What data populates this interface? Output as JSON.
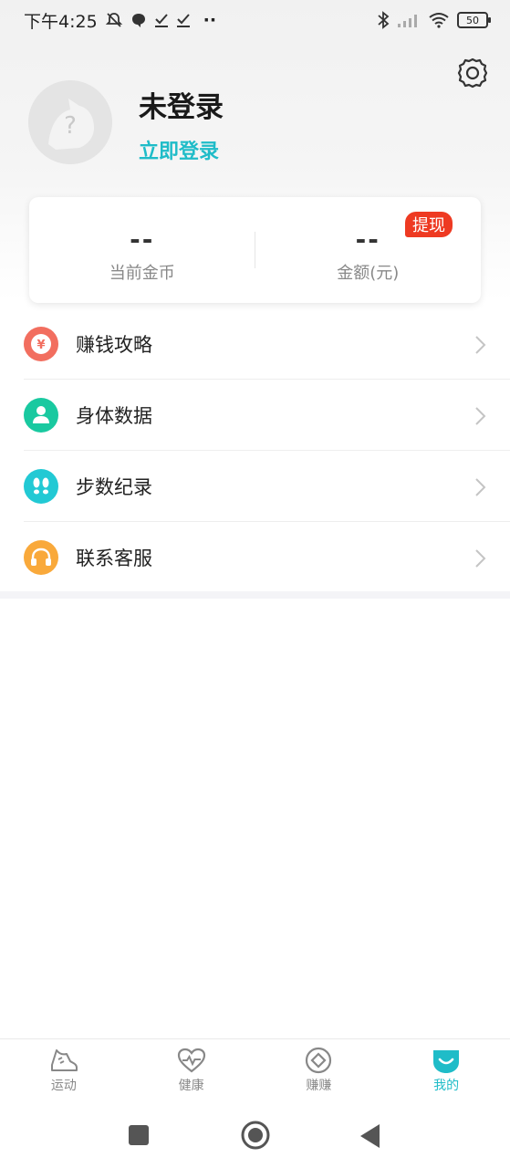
{
  "status_bar": {
    "time": "下午4:25",
    "dots": "··",
    "battery": "50"
  },
  "profile": {
    "name": "未登录",
    "login_link": "立即登录"
  },
  "stats": {
    "coins_value": "--",
    "coins_label": "当前金币",
    "amount_value": "--",
    "amount_label": "金额(元)",
    "withdraw_badge": "提现"
  },
  "menu": {
    "items": [
      {
        "label": "赚钱攻略",
        "icon": "yen-icon",
        "color": "#f26e5f"
      },
      {
        "label": "身体数据",
        "icon": "person-icon",
        "color": "#19c9a0"
      },
      {
        "label": "步数纪录",
        "icon": "footprints-icon",
        "color": "#22c9d4"
      },
      {
        "label": "联系客服",
        "icon": "headphones-icon",
        "color": "#f9a93b"
      }
    ]
  },
  "tabs": [
    {
      "label": "运动",
      "icon": "shoe-icon"
    },
    {
      "label": "健康",
      "icon": "heart-pulse-icon"
    },
    {
      "label": "赚赚",
      "icon": "diamond-coin-icon"
    },
    {
      "label": "我的",
      "icon": "smile-icon",
      "active": true
    }
  ],
  "colors": {
    "accent": "#1fbcc8",
    "badge": "#ee3a22"
  }
}
